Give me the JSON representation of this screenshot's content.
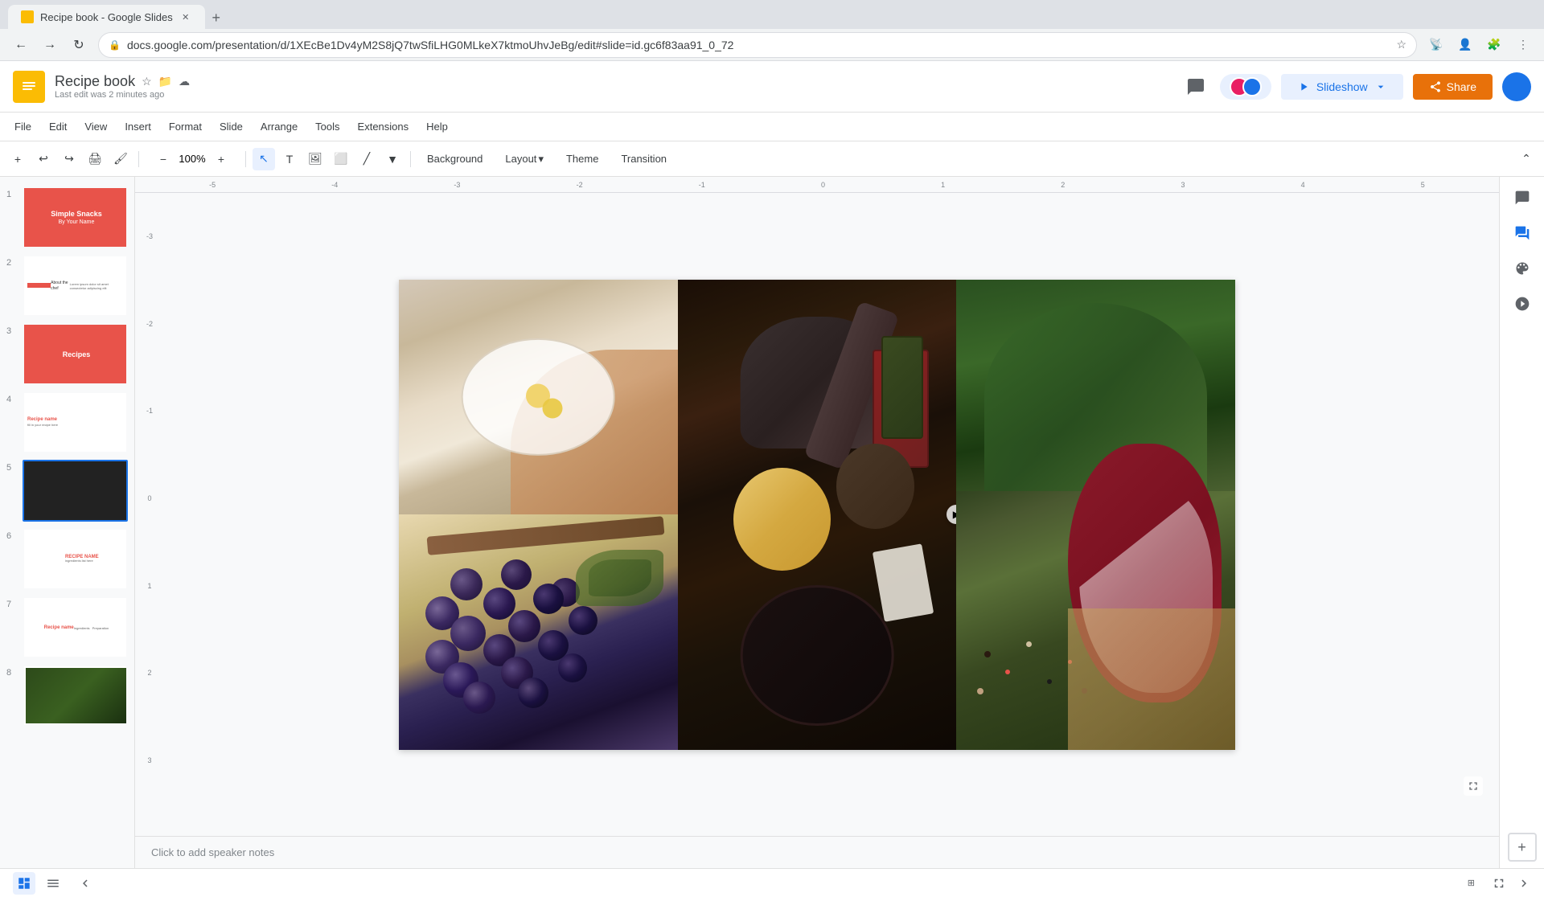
{
  "browser": {
    "tab_title": "Recipe book - Google Slides",
    "url": "docs.google.com/presentation/d/1XEcBe1Dv4yM2S8jQ7twSfiLHG0MLkeX7ktmoUhvJeBg/edit#slide=id.gc6f83aa91_0_72",
    "back_disabled": false,
    "forward_disabled": false
  },
  "app": {
    "title": "Recipe book",
    "logo_char": "S",
    "last_edit": "Last edit was 2 minutes ago",
    "slideshow_label": "Slideshow",
    "share_label": "Share"
  },
  "menu": {
    "items": [
      "File",
      "Edit",
      "View",
      "Insert",
      "Format",
      "Slide",
      "Arrange",
      "Tools",
      "Extensions",
      "Help"
    ]
  },
  "toolbar": {
    "zoom_pct": "100%",
    "background_label": "Background",
    "layout_label": "Layout",
    "theme_label": "Theme",
    "transition_label": "Transition"
  },
  "slides": [
    {
      "num": "1",
      "type": "title"
    },
    {
      "num": "2",
      "type": "text"
    },
    {
      "num": "3",
      "type": "red-title"
    },
    {
      "num": "4",
      "type": "recipe"
    },
    {
      "num": "5",
      "type": "photos"
    },
    {
      "num": "6",
      "type": "recipe2"
    },
    {
      "num": "7",
      "type": "recipe3"
    },
    {
      "num": "8",
      "type": "herbs"
    }
  ],
  "notes": {
    "placeholder": "Click to add speaker notes"
  },
  "expand_btn": "+",
  "nav_arrow": "▶"
}
